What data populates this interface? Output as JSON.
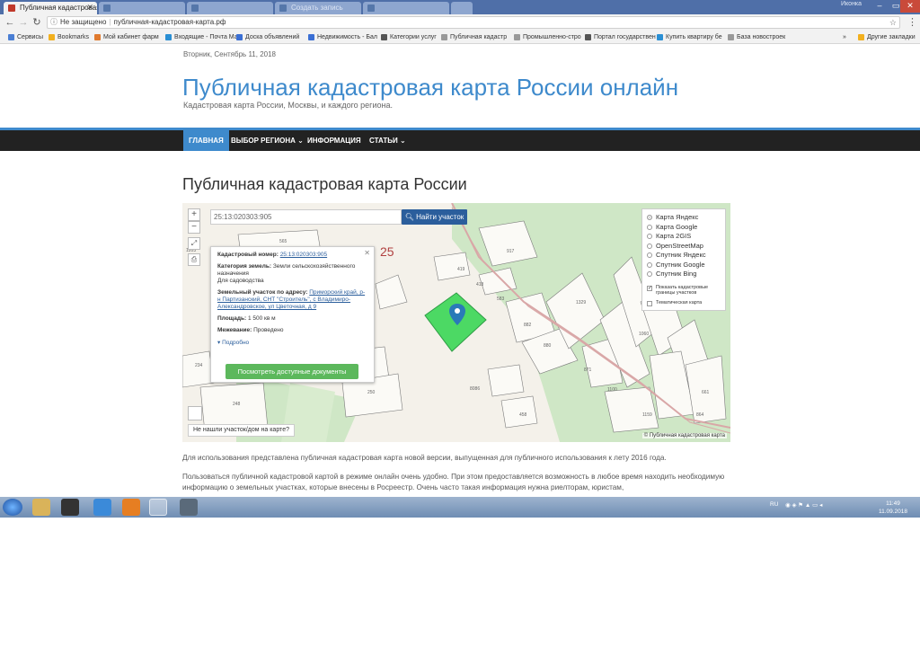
{
  "browser": {
    "active_tab_title": "Публичная кадастровая к",
    "inactive_tabs": [
      "",
      "",
      "Создать запись",
      ""
    ],
    "security_label": "Не защищено",
    "url": "публичная-кадастровая-карта.рф",
    "profile_label": "Иконка"
  },
  "bookmarks": [
    {
      "label": "Сервисы",
      "color": "#4a7fd4"
    },
    {
      "label": "Bookmarks",
      "color": "#f2b01e"
    },
    {
      "label": "Мой кабинет фарм",
      "color": "#e07a2e"
    },
    {
      "label": "Входящие - Почта Ма",
      "color": "#2a8fd4"
    },
    {
      "label": "Доска объявлений",
      "color": "#3a6fd4"
    },
    {
      "label": "Недвижимость - Бал",
      "color": "#3a6fd4"
    },
    {
      "label": "Категории услуг",
      "color": "#555"
    },
    {
      "label": "Публичная кадастр",
      "color": "#999"
    },
    {
      "label": "Промышленно-стро",
      "color": "#999"
    },
    {
      "label": "Портал государствен",
      "color": "#555"
    },
    {
      "label": "Купить квартиру бе",
      "color": "#2a8fd4"
    },
    {
      "label": "База новостроек",
      "color": "#999"
    },
    {
      "label": "Другие закладки",
      "color": "#f2b01e"
    }
  ],
  "page": {
    "date": "Вторник, Сентябрь 11, 2018",
    "site_title": "Публичная кадастровая карта России онлайн",
    "site_desc": "Кадастровая карта России, Москвы, и каждого региона.",
    "nav": [
      {
        "label": "ГЛАВНАЯ",
        "active": true
      },
      {
        "label": "ВЫБОР РЕГИОНА ⌄",
        "active": false
      },
      {
        "label": "ИНФОРМАЦИЯ",
        "active": false
      },
      {
        "label": "СТАТЬИ ⌄",
        "active": false
      }
    ],
    "heading": "Публичная кадастровая карта России",
    "paragraph1": "Для использования представлена публичная кадастровая карта новой версии, выпущенная для публичного использования к лету 2016 года.",
    "paragraph2": "Пользоваться публичной кадастровой картой в режиме онлайн очень удобно. При этом предоставляется возможность в любое время находить необходимую информацию о земельных участках, которые внесены в Росреестр. Очень часто такая информация нужна риелторам, юристам,"
  },
  "map": {
    "search_value": "25:13:020303:905",
    "find_button": "Найти участок",
    "region_number": "25",
    "popup": {
      "cad_label": "Кадастровый номер:",
      "cad_value": "25:13:020303:905",
      "category_label": "Категория земель:",
      "category_value": "Земли сельскохозяйственного назначения",
      "use_value": "Для садоводства",
      "address_label": "Земельный участок по адресу:",
      "address_value": "Приморский край, р-н Партизанский, СНТ \"Строитель\", с Владимиро-Александровское, ул Цветочная, д 9",
      "area_label": "Площадь:",
      "area_value": "1 500 кв м",
      "survey_label": "Межевание:",
      "survey_value": "Проведено",
      "more_link": "Подробно",
      "docs_button": "Посмотреть доступные документы"
    },
    "layers": [
      {
        "label": "Карта Яндекс",
        "selected": true
      },
      {
        "label": "Карта Google",
        "selected": false
      },
      {
        "label": "Карта 2GIS",
        "selected": false
      },
      {
        "label": "OpenStreetMap",
        "selected": false
      },
      {
        "label": "Спутник Яндекс",
        "selected": false
      },
      {
        "label": "Спутник Google",
        "selected": false
      },
      {
        "label": "Спутник Bing",
        "selected": false
      }
    ],
    "show_borders_label": "Показать кадастровые границы участков",
    "thematic_label": "Тематическая карта",
    "not_found_label": "Не нашли участок/дом на карте?",
    "copyright": "© Публичная кадастровая карта",
    "plot_numbers": [
      "565",
      "1203",
      "419",
      "418",
      "917",
      "583",
      "882",
      "880",
      "1329",
      "1060",
      "871",
      "1100",
      "1159",
      "8086",
      "458",
      "234",
      "248",
      "250",
      "864",
      "661"
    ],
    "colors": {
      "plot_fill": "#4cd964",
      "pin": "#2a7ab8",
      "green_area": "#cfe7c6",
      "road": "#d9a7a7"
    }
  },
  "taskbar": {
    "lang": "RU",
    "time": "11:49",
    "date": "11.09.2018"
  }
}
